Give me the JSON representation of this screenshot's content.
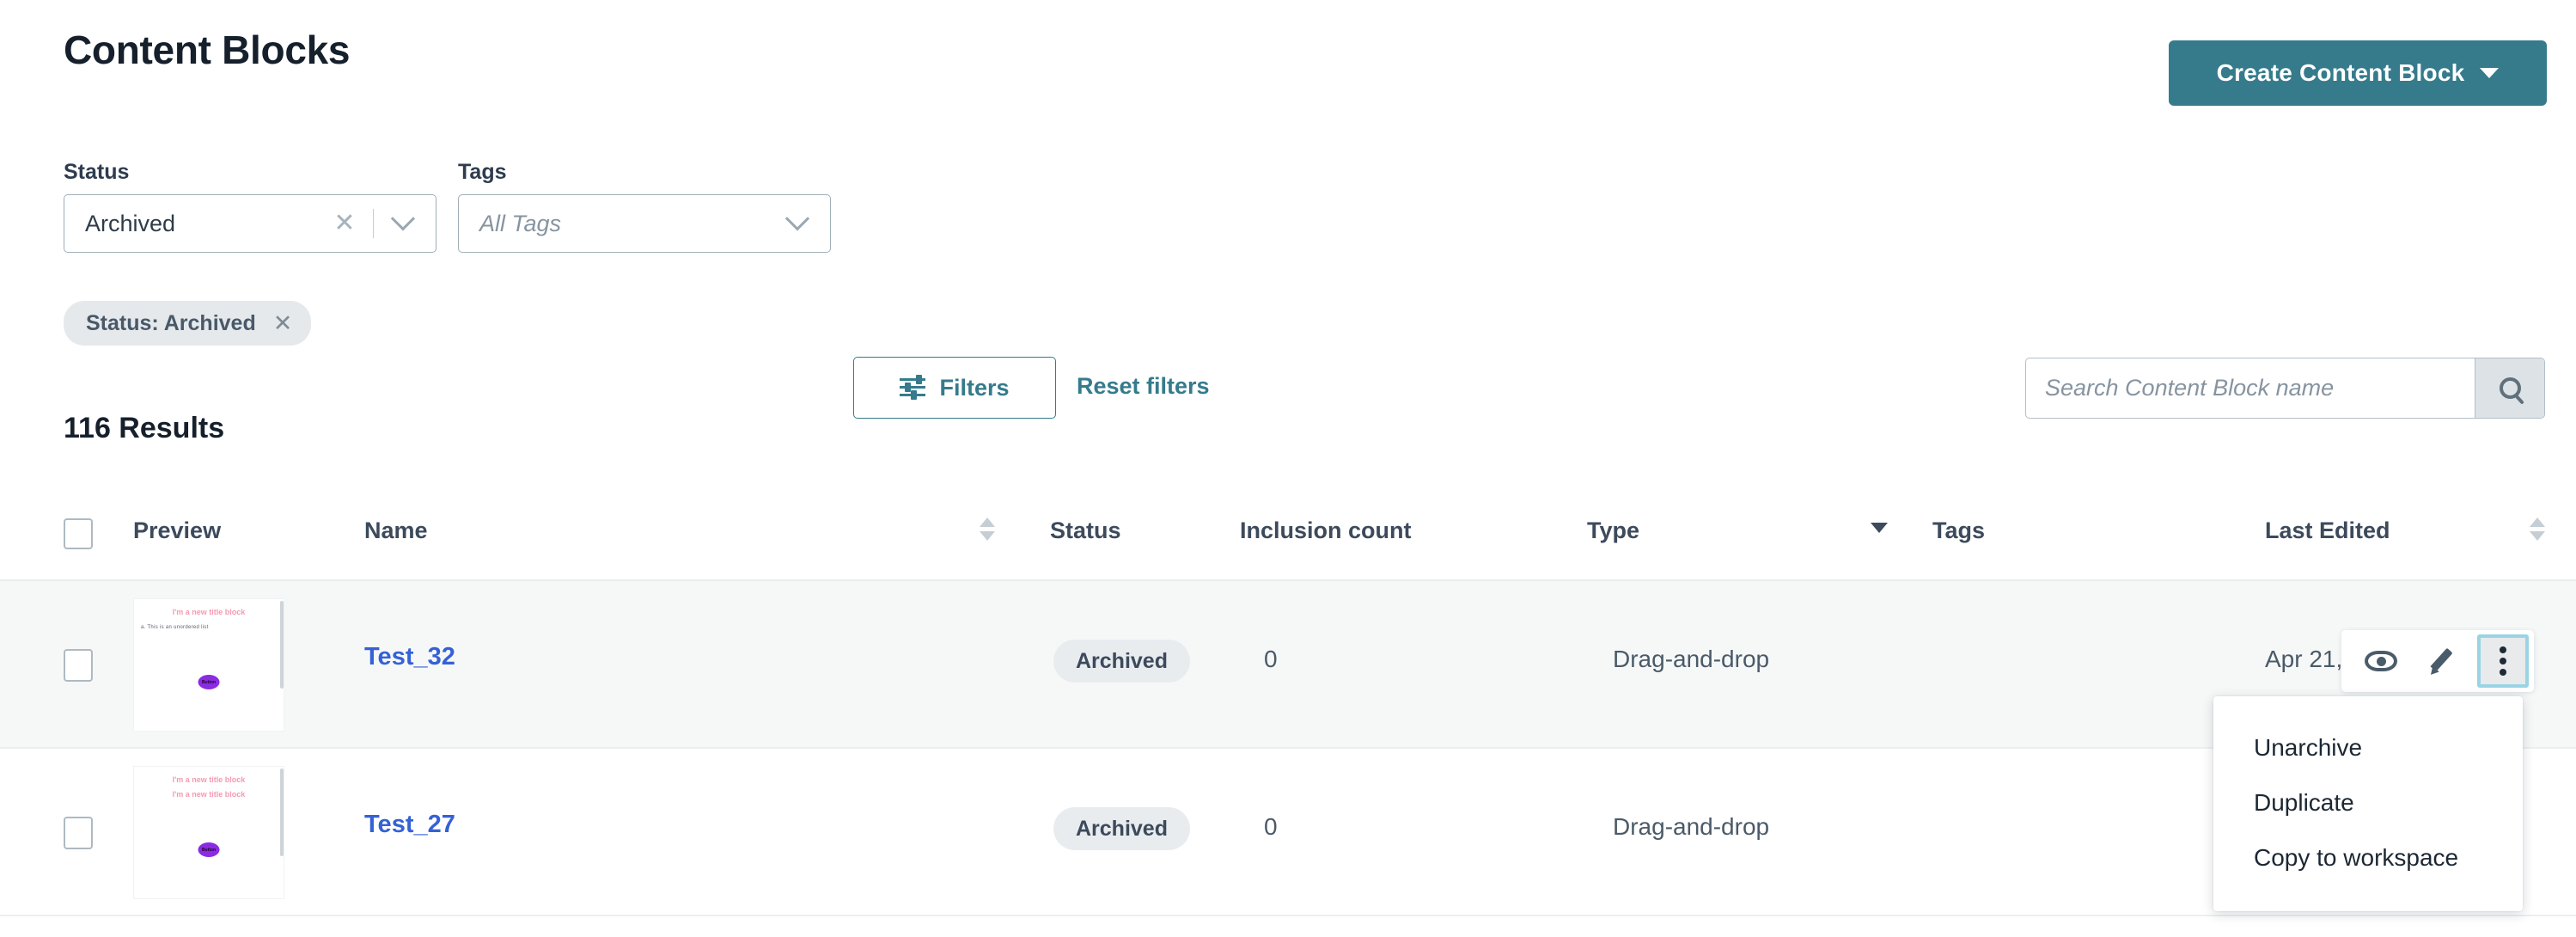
{
  "header": {
    "title": "Content Blocks",
    "create_button": "Create Content Block"
  },
  "filters": {
    "status": {
      "label": "Status",
      "value": "Archived"
    },
    "tags": {
      "label": "Tags",
      "placeholder": "All Tags"
    },
    "filters_button": "Filters",
    "reset_link": "Reset filters",
    "search": {
      "placeholder": "Search Content Block name",
      "value": ""
    },
    "chips": [
      {
        "label": "Status: Archived"
      }
    ]
  },
  "results": {
    "count_label": "116 Results",
    "columns": [
      {
        "key": "preview",
        "label": "Preview",
        "sortable": false
      },
      {
        "key": "name",
        "label": "Name",
        "sortable": true,
        "sort": "none"
      },
      {
        "key": "status",
        "label": "Status",
        "sortable": false
      },
      {
        "key": "inclusion_count",
        "label": "Inclusion count",
        "sortable": false
      },
      {
        "key": "type",
        "label": "Type",
        "sortable": true,
        "sort": "desc"
      },
      {
        "key": "tags",
        "label": "Tags",
        "sortable": false
      },
      {
        "key": "last_edited",
        "label": "Last Edited",
        "sortable": true,
        "sort": "none"
      }
    ],
    "rows": [
      {
        "name": "Test_32",
        "status": "Archived",
        "inclusion_count": "0",
        "type": "Drag-and-drop",
        "tags": "",
        "last_edited": "Apr 21,",
        "preview": {
          "titles": [
            "I'm a new title block"
          ],
          "list_item": "a. This is an unordered list",
          "button_label": "Button"
        }
      },
      {
        "name": "Test_27",
        "status": "Archived",
        "inclusion_count": "0",
        "type": "Drag-and-drop",
        "tags": "",
        "last_edited": "",
        "preview": {
          "titles": [
            "I'm a new title block",
            "I'm a new title block"
          ],
          "list_item": "",
          "button_label": "Button"
        }
      }
    ]
  },
  "row_actions": {
    "preview_icon": "eye-icon",
    "edit_icon": "pencil-icon",
    "more_icon": "kebab-menu-icon"
  },
  "context_menu": {
    "items": [
      "Unarchive",
      "Duplicate",
      "Copy to workspace"
    ]
  },
  "colors": {
    "brand": "#357b8c",
    "link": "#3461d6",
    "focus_ring": "#9ad4e4",
    "badge_bg": "#e9ecef"
  }
}
